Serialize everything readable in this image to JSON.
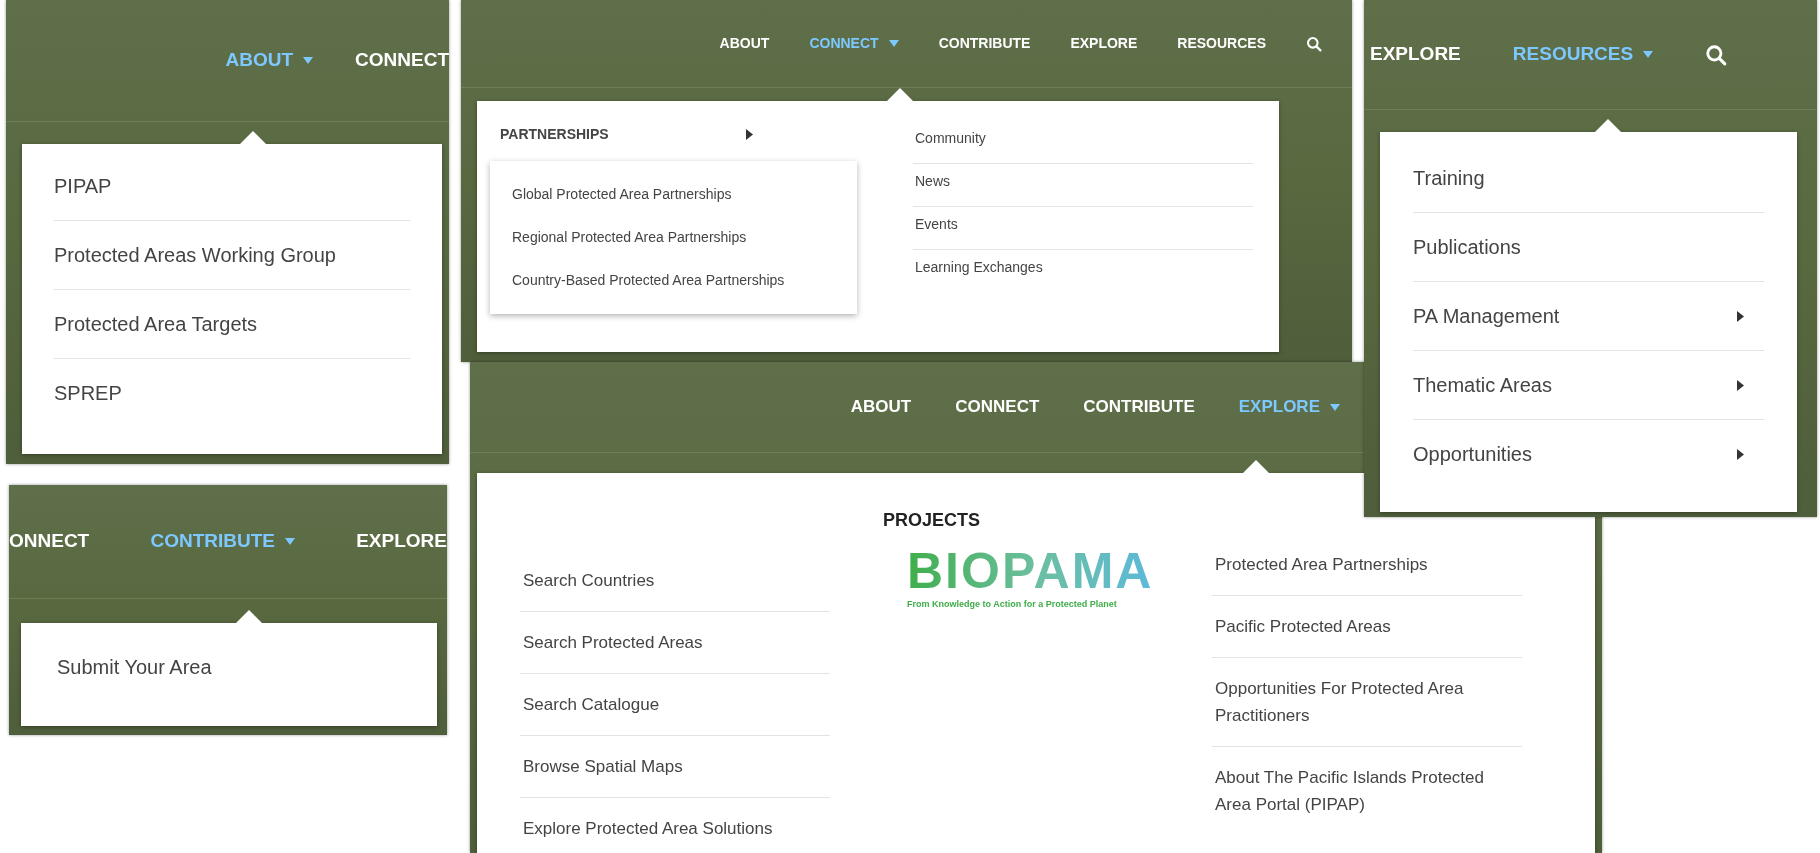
{
  "panels": [
    {
      "kind": "list",
      "nav": [
        {
          "label": "ABOUT",
          "selected": true
        },
        {
          "label": "CONNECT",
          "selected": false
        }
      ],
      "menu": {
        "items": [
          {
            "label": "PIPAP",
            "submenu": false
          },
          {
            "label": "Protected Areas Working Group",
            "submenu": false
          },
          {
            "label": "Protected Area Targets",
            "submenu": false
          },
          {
            "label": "SPREP",
            "submenu": false
          }
        ]
      }
    },
    {
      "kind": "split",
      "nav": [
        {
          "label": "ABOUT",
          "selected": false
        },
        {
          "label": "CONNECT",
          "selected": true
        },
        {
          "label": "CONTRIBUTE",
          "selected": false
        },
        {
          "label": "EXPLORE",
          "selected": false
        },
        {
          "label": "RESOURCES",
          "selected": false
        }
      ],
      "search": true,
      "menu": {
        "group": {
          "label": "PARTNERSHIPS",
          "submenu": true,
          "children": [
            {
              "label": "Global Protected Area Partnerships"
            },
            {
              "label": "Regional Protected Area Partnerships"
            },
            {
              "label": "Country-Based Protected Area Partnerships"
            }
          ]
        },
        "items": [
          {
            "label": "Community",
            "submenu": false
          },
          {
            "label": "News",
            "submenu": false
          },
          {
            "label": "Events",
            "submenu": false
          },
          {
            "label": "Learning Exchanges",
            "submenu": false
          }
        ]
      }
    },
    {
      "kind": "list",
      "nav": [
        {
          "label": "EXPLORE",
          "selected": false
        },
        {
          "label": "RESOURCES",
          "selected": true
        }
      ],
      "search": true,
      "menu": {
        "items": [
          {
            "label": "Training",
            "submenu": false
          },
          {
            "label": "Publications",
            "submenu": false
          },
          {
            "label": "PA Management",
            "submenu": true
          },
          {
            "label": "Thematic Areas",
            "submenu": true
          },
          {
            "label": "Opportunities",
            "submenu": true
          }
        ]
      }
    },
    {
      "kind": "list",
      "nav": [
        {
          "label": "ONNECT",
          "selected": false
        },
        {
          "label": "CONTRIBUTE",
          "selected": true
        },
        {
          "label": "EXPLORE",
          "selected": false
        }
      ],
      "menu": {
        "items": [
          {
            "label": "Submit Your Area",
            "submenu": false
          }
        ]
      }
    },
    {
      "kind": "mega",
      "nav": [
        {
          "label": "ABOUT",
          "selected": false
        },
        {
          "label": "CONNECT",
          "selected": false
        },
        {
          "label": "CONTRIBUTE",
          "selected": false
        },
        {
          "label": "EXPLORE",
          "selected": true
        }
      ],
      "menu": {
        "left": [
          {
            "label": "Search Countries"
          },
          {
            "label": "Search Protected Areas"
          },
          {
            "label": "Search Catalogue"
          },
          {
            "label": "Browse Spatial Maps"
          },
          {
            "label": "Explore Protected Area Solutions"
          }
        ],
        "heading": "PROJECTS",
        "logo": {
          "name": "BIOPAMA",
          "tagline": "From Knowledge to Action for a Protected Planet"
        },
        "right": [
          {
            "label": "Protected Area Partnerships"
          },
          {
            "label": "Pacific Protected Areas"
          },
          {
            "label": "Opportunities For Protected Area Practitioners"
          },
          {
            "label": "About The Pacific Islands Protected Area Portal (PIPAP)"
          }
        ]
      }
    }
  ]
}
